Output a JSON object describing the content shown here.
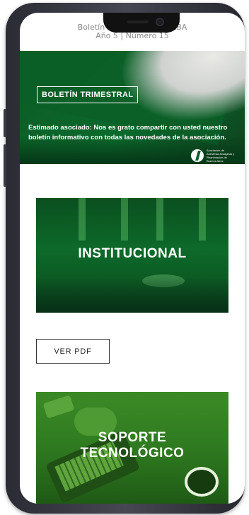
{
  "preheader": {
    "line1": "Boletín Informativo AAARBA",
    "line2": "Año 5 | Número 15"
  },
  "hero": {
    "tag": "BOLETÍN TRIMESTRAL",
    "message": "Estimado asociado: Nos es grato compartir con usted nuestro boletín informativo con todas las novedades de la asociación.",
    "logo_text": "Asociación de Anestesia Analgesia y Reanimación de Buenos Aires"
  },
  "sections": {
    "institucional": "INSTITUCIONAL",
    "ver_pdf": "VER PDF",
    "soporte_line1": "SOPORTE",
    "soporte_line2": "TECNOLÓGICO"
  },
  "colors": {
    "brand_green": "#0b5f27",
    "accent_green": "#3b8a26"
  }
}
